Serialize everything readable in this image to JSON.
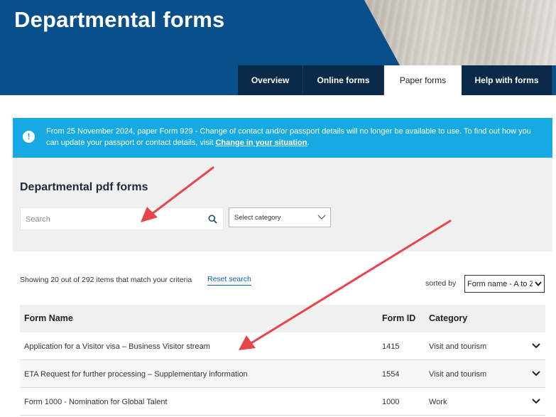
{
  "header": {
    "title": "Departmental forms",
    "tabs": [
      {
        "label": "Overview",
        "active": false
      },
      {
        "label": "Online forms",
        "active": false
      },
      {
        "label": "Paper forms",
        "active": true
      },
      {
        "label": "Help with forms",
        "active": false
      }
    ]
  },
  "alert": {
    "icon": "exclamation-icon",
    "text": "From 25 November 2024, paper Form 929 - Change of contact and/or passport details will no longer be available to use. To find out how you can update your passport or contact details, visit ",
    "link_text": "Change in your situation",
    "suffix": "."
  },
  "filters": {
    "title": "Departmental pdf forms",
    "search_placeholder": "Search",
    "search_value": "",
    "category_selected": "Select category"
  },
  "results": {
    "summary": "Showing 20 out of 292 items that match your criteria",
    "reset_label": "Reset search",
    "sorted_label": "sorted by",
    "sort_selected": "Form name - A to Z"
  },
  "table": {
    "headers": {
      "name": "Form Name",
      "id": "Form ID",
      "category": "Category"
    },
    "rows": [
      {
        "name": "Application for a Visitor visa – Business Visitor stream",
        "id": "1415",
        "category": "Visit and tourism"
      },
      {
        "name": "ETA Request for further processing – Supplementary information",
        "id": "1554",
        "category": "Visit and tourism"
      },
      {
        "name": "Form 1000 - Nomination for Global Talent",
        "id": "1000",
        "category": "Work"
      }
    ]
  },
  "colors": {
    "header_blue": "#094f8c",
    "tab_dark": "#0b2a4a",
    "alert_blue": "#17a9e1",
    "annotation_red": "#e8454a",
    "link_blue": "#0b5ea8"
  }
}
